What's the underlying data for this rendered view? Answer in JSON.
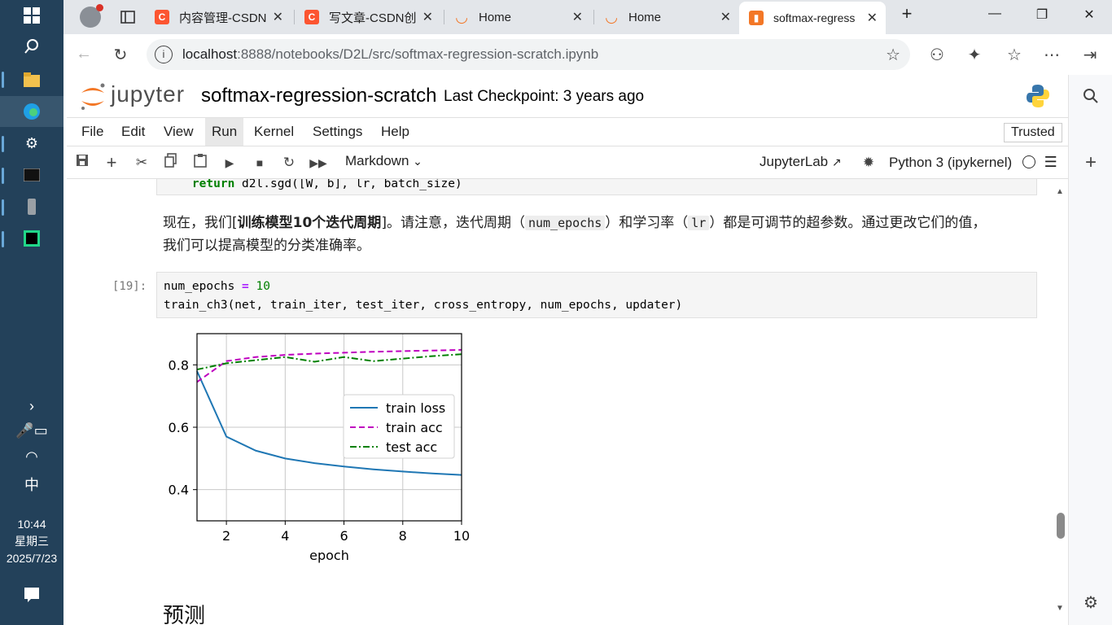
{
  "taskbar": {
    "time": "10:44",
    "weekday": "星期三",
    "date": "2025/7/23",
    "ime": "中"
  },
  "tabs": [
    {
      "title": "内容管理-CSDN"
    },
    {
      "title": "写文章-CSDN创"
    },
    {
      "title": "Home"
    },
    {
      "title": "Home"
    },
    {
      "title": "softmax-regress"
    }
  ],
  "address": {
    "host": "localhost",
    "path": ":8888/notebooks/D2L/src/softmax-regression-scratch.ipynb"
  },
  "jupyter": {
    "logo": "jupyter",
    "notebook_title": "softmax-regression-scratch",
    "checkpoint": "Last Checkpoint: 3 years ago",
    "menu": [
      "File",
      "Edit",
      "View",
      "Run",
      "Kernel",
      "Settings",
      "Help"
    ],
    "trusted": "Trusted",
    "cell_type": "Markdown",
    "jupyterlab": "JupyterLab",
    "kernel": "Python 3 (ipykernel)"
  },
  "cells": {
    "prev_code_tail": {
      "kw": "return",
      "rest": " d2l.sgd([W, b], lr, batch_size)"
    },
    "md1": {
      "p1": "现在，我们[",
      "bold": "训练模型10个迭代周期",
      "p2": "]。请注意，迭代周期（",
      "code1": "num_epochs",
      "p3": "）和学习率（",
      "code2": "lr",
      "p4": "）都是可调节的超参数。通过更改它们的值，",
      "p5": "我们可以提高模型的分类准确率。"
    },
    "code19": {
      "prompt": "[19]:",
      "line1_a": "num_epochs ",
      "line1_op": "=",
      "line1_num": " 10",
      "line2": "train_ch3(net, train_iter, test_iter, cross_entropy, num_epochs, updater)"
    },
    "md_heading": "预测"
  },
  "chart_data": {
    "type": "line",
    "xlabel": "epoch",
    "ylabel": "",
    "xlim": [
      1,
      10
    ],
    "ylim": [
      0.3,
      0.9
    ],
    "xticks": [
      2,
      4,
      6,
      8,
      10
    ],
    "yticks": [
      0.4,
      0.6,
      0.8
    ],
    "grid": true,
    "legend": "center-right",
    "x": [
      1,
      2,
      3,
      4,
      5,
      6,
      7,
      8,
      9,
      10
    ],
    "series": [
      {
        "name": "train loss",
        "color": "#1f77b4",
        "dash": "solid",
        "values": [
          0.78,
          0.57,
          0.525,
          0.5,
          0.485,
          0.474,
          0.465,
          0.458,
          0.452,
          0.447
        ]
      },
      {
        "name": "train acc",
        "color": "#bf00bf",
        "dash": "dashed",
        "values": [
          0.745,
          0.812,
          0.825,
          0.832,
          0.836,
          0.839,
          0.842,
          0.844,
          0.846,
          0.848
        ]
      },
      {
        "name": "test acc",
        "color": "#008000",
        "dash": "dashdot",
        "values": [
          0.785,
          0.805,
          0.815,
          0.825,
          0.81,
          0.825,
          0.812,
          0.82,
          0.828,
          0.834
        ]
      }
    ]
  }
}
